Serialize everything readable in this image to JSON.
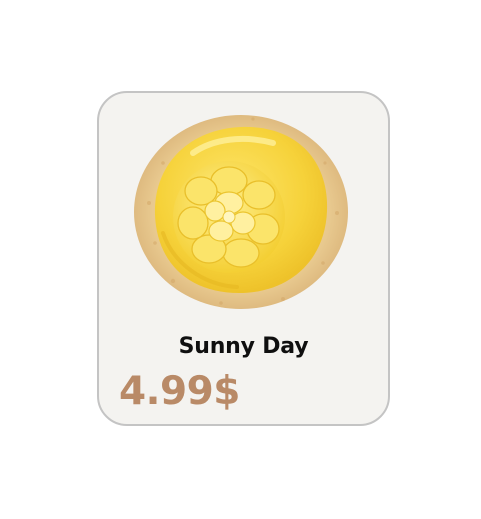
{
  "product": {
    "name": "Sunny Day",
    "price": "4.99$",
    "image_icon": "frosted-cookie-icon"
  },
  "colors": {
    "price": "#b98a67",
    "card_background": "#f4f3f0",
    "card_border": "#c4c4c4",
    "frosting": "#f6d63a",
    "cookie": "#e6c88f"
  }
}
